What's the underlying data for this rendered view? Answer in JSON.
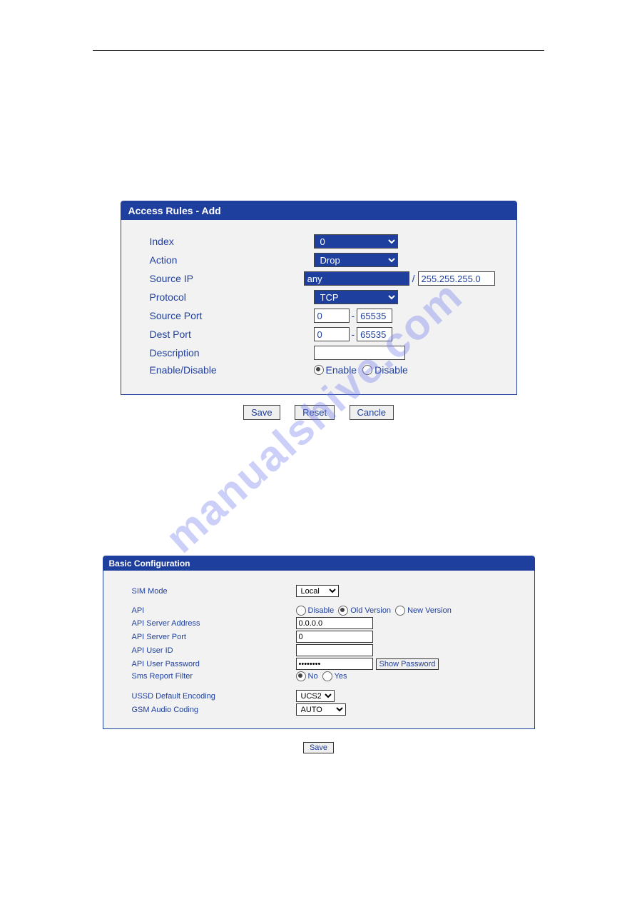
{
  "watermark": "manualshive.com",
  "panel1": {
    "title": "Access Rules - Add",
    "rows": {
      "index": {
        "label": "Index",
        "value": "0"
      },
      "action": {
        "label": "Action",
        "value": "Drop"
      },
      "sourceIp": {
        "label": "Source IP",
        "value": "any",
        "sep": "/",
        "mask": "255.255.255.0"
      },
      "protocol": {
        "label": "Protocol",
        "value": "TCP"
      },
      "sourcePort": {
        "label": "Source Port",
        "from": "0",
        "sep": "-",
        "to": "65535"
      },
      "destPort": {
        "label": "Dest Port",
        "from": "0",
        "sep": "-",
        "to": "65535"
      },
      "description": {
        "label": "Description",
        "value": ""
      },
      "enableDisable": {
        "label": "Enable/Disable",
        "opt1": "Enable",
        "opt2": "Disable"
      }
    },
    "buttons": {
      "save": "Save",
      "reset": "Reset",
      "cancel": "Cancle"
    }
  },
  "panel2": {
    "title": "Basic Configuration",
    "rows": {
      "simMode": {
        "label": "SIM Mode",
        "value": "Local"
      },
      "api": {
        "label": "API",
        "opt1": "Disable",
        "opt2": "Old Version",
        "opt3": "New Version"
      },
      "apiServerAddress": {
        "label": "API Server Address",
        "value": "0.0.0.0"
      },
      "apiServerPort": {
        "label": "API Server Port",
        "value": "0"
      },
      "apiUserId": {
        "label": "API User ID",
        "value": ""
      },
      "apiUserPassword": {
        "label": "API User Password",
        "value": "••••••••",
        "button": "Show Password"
      },
      "smsReportFilter": {
        "label": "Sms Report Filter",
        "opt1": "No",
        "opt2": "Yes"
      },
      "ussdEncoding": {
        "label": "USSD Default Encoding",
        "value": "UCS2"
      },
      "gsmAudioCoding": {
        "label": "GSM Audio Coding",
        "value": "AUTO"
      }
    },
    "buttons": {
      "save": "Save"
    }
  }
}
